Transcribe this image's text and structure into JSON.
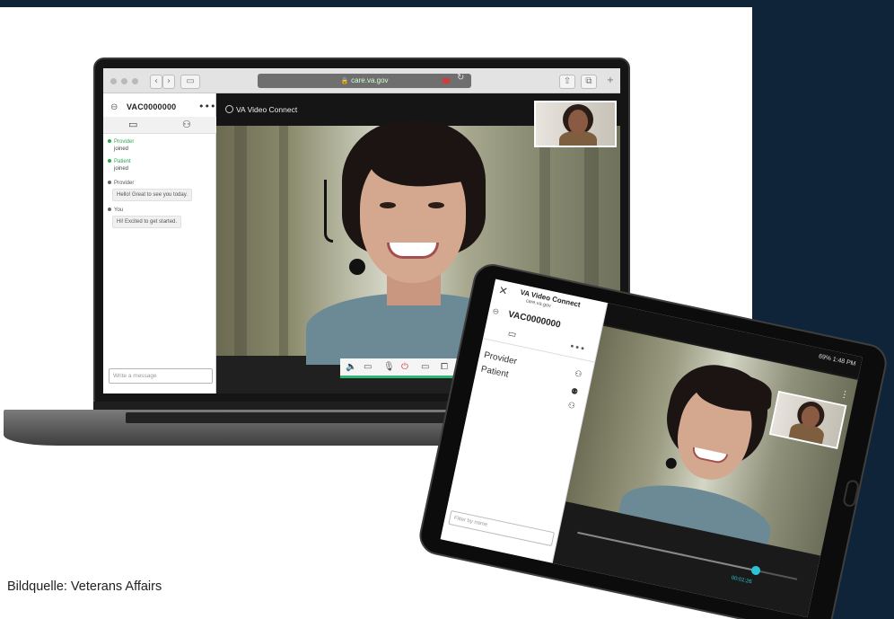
{
  "caption": "Bildquelle: Veterans Affairs",
  "laptop": {
    "browser": {
      "url": "care.va.gov"
    },
    "sidebar": {
      "room_id": "VAC0000000",
      "messages": [
        {
          "who": "Provider",
          "text": "joined",
          "role": "green"
        },
        {
          "who": "Patient",
          "text": "joined",
          "role": "green"
        },
        {
          "who": "Provider",
          "bubble": "Hello! Great to see you today.",
          "role": "gray"
        },
        {
          "who": "You",
          "bubble": "Hi! Excited to get started.",
          "role": "gray"
        }
      ],
      "message_placeholder": "Write a message"
    },
    "video": {
      "title": "VA Video Connect"
    }
  },
  "tablet": {
    "title": "VA Video Connect",
    "url": "care.va.gov",
    "room_id": "VAC0000000",
    "participants": [
      "Provider",
      "Patient"
    ],
    "filter_placeholder": "Filter by name",
    "status": "69% 1:48 PM",
    "elapsed": "00:01:26"
  },
  "colors": {
    "navy": "#0f2438",
    "accent_green": "#2ca84e",
    "accent_cyan": "#2dc3d6",
    "end_call_red": "#d43c3c"
  },
  "icons": {
    "link": "chain-link-icon",
    "chat": "chat-bubble-icon",
    "people": "people-icon",
    "speaker": "speaker-icon",
    "camera": "video-camera-icon",
    "mic": "microphone-icon",
    "end_call": "power-icon",
    "screen": "monitor-icon",
    "share": "share-icon",
    "collapse": "collapse-icon"
  }
}
